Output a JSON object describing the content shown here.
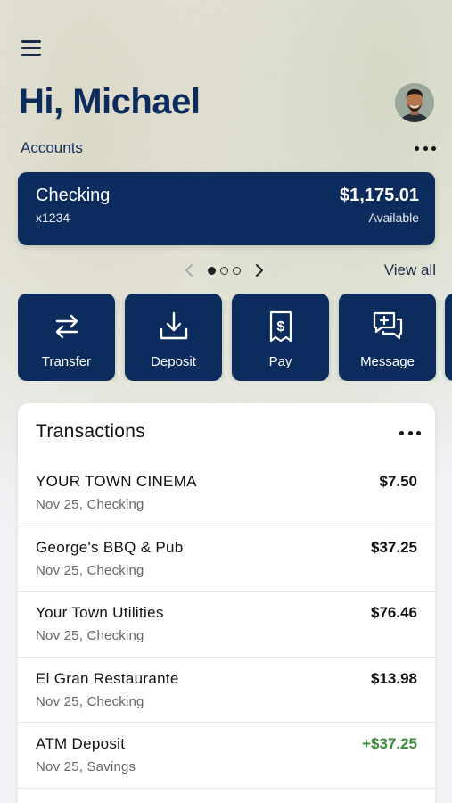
{
  "header": {
    "greeting": "Hi, Michael",
    "avatar_icon": "user-avatar-icon",
    "menu_icon": "hamburger-menu-icon"
  },
  "accounts": {
    "label": "Accounts",
    "more_icon": "more-horizontal-icon",
    "card": {
      "name": "Checking",
      "number": "x1234",
      "balance": "$1,175.01",
      "balance_label": "Available"
    },
    "pager": {
      "pages": 3,
      "current": 1
    },
    "view_all": "View all"
  },
  "actions": [
    {
      "label": "Transfer",
      "icon": "transfer-arrows-icon"
    },
    {
      "label": "Deposit",
      "icon": "deposit-download-icon"
    },
    {
      "label": "Pay",
      "icon": "bill-dollar-icon"
    },
    {
      "label": "Message",
      "icon": "message-chat-icon"
    }
  ],
  "transactions": {
    "title": "Transactions",
    "items": [
      {
        "name": "YOUR TOWN CINEMA",
        "sub": "Nov 25, Checking",
        "amount": "$7.50",
        "credit": false
      },
      {
        "name": "George's BBQ & Pub",
        "sub": "Nov 25, Checking",
        "amount": "$37.25",
        "credit": false
      },
      {
        "name": "Your Town Utilities",
        "sub": "Nov 25, Checking",
        "amount": "$76.46",
        "credit": false
      },
      {
        "name": "El Gran Restaurante",
        "sub": "Nov 25, Checking",
        "amount": "$13.98",
        "credit": false
      },
      {
        "name": "ATM Deposit",
        "sub": "Nov 25, Savings",
        "amount": "+$37.25",
        "credit": true
      }
    ]
  },
  "colors": {
    "brand_navy": "#0c2c5e",
    "credit_green": "#3a8a3a"
  }
}
